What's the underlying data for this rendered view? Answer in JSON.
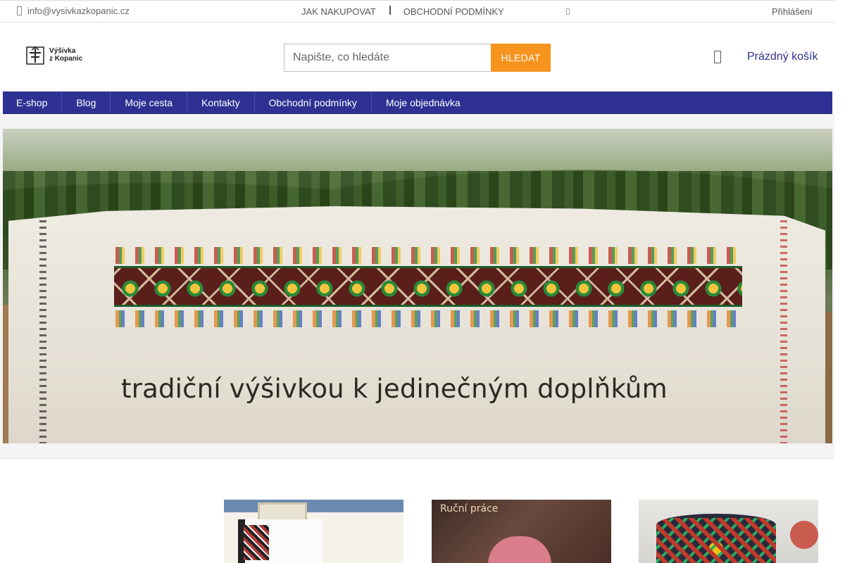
{
  "topbar": {
    "email": "info@vysivkazkopanic.cz",
    "links": [
      "JAK NAKUPOVAT",
      "OBCHODNÍ PODMÍNKY"
    ],
    "login": "Přihlášení"
  },
  "header": {
    "logo_line1": "Výšivka",
    "logo_line2": "z Kopanic",
    "search_placeholder": "Napište, co hledáte",
    "search_button": "HLEDAT",
    "cart_label": "Prázdný košík"
  },
  "nav": {
    "items": [
      "E-shop",
      "Blog",
      "Moje cesta",
      "Kontakty",
      "Obchodní podmínky",
      "Moje objednávka"
    ]
  },
  "hero": {
    "slogan": "tradiční výšivkou k jedinečným doplňkům"
  },
  "cards": {
    "card2_tag": "Ruční práce"
  },
  "colors": {
    "nav_bg": "#2e3192",
    "search_button": "#f7941e",
    "cart_text": "#2e3192"
  },
  "icons": [
    "phone-icon",
    "social-icon",
    "cart-icon",
    "logo-emblem"
  ]
}
